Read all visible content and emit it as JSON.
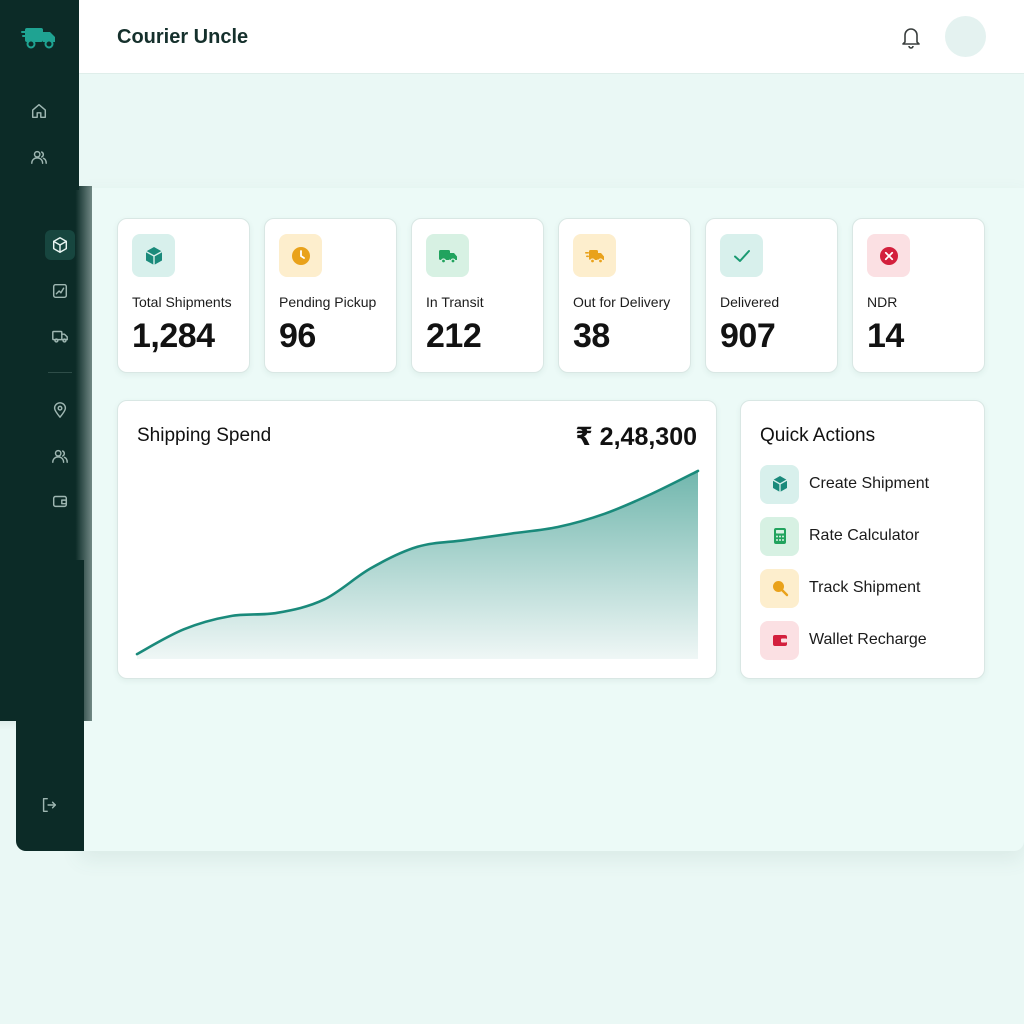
{
  "app": {
    "brand": "Courier Uncle"
  },
  "colors": {
    "sidebar": "#0c2b27",
    "accent": "#1a8a7b",
    "teal_bg": "#d8f0ec",
    "amber": "#e9a21b",
    "amber_bg": "#fdeecd",
    "green": "#21a35e",
    "green_bg": "#d7f1e3",
    "red": "#d3203d",
    "red_bg": "#fbe0e3"
  },
  "sidebar": {
    "logo_icon": "truck-icon",
    "items": [
      {
        "icon": "home-icon",
        "active": false
      },
      {
        "icon": "users-icon",
        "active": false
      },
      {
        "icon": "package-icon",
        "active": true
      },
      {
        "icon": "chart-icon",
        "active": false
      },
      {
        "icon": "truck-icon",
        "active": false
      },
      {
        "icon": "location-icon",
        "active": false
      },
      {
        "icon": "users-icon",
        "active": false
      },
      {
        "icon": "wallet-icon",
        "active": false
      },
      {
        "icon": "logout-icon",
        "active": false
      }
    ]
  },
  "header": {
    "bell_icon": "bell-icon",
    "avatar": "avatar"
  },
  "stats": [
    {
      "label": "Total Shipments",
      "value": "1,284",
      "icon": "package-icon"
    },
    {
      "label": "Pending Pickup",
      "value": "96",
      "icon": "clock-icon"
    },
    {
      "label": "In Transit",
      "value": "212",
      "icon": "truck-icon"
    },
    {
      "label": "Out for Delivery",
      "value": "38",
      "icon": "fast-truck-icon"
    },
    {
      "label": "Delivered",
      "value": "907",
      "icon": "check-icon"
    },
    {
      "label": "NDR",
      "value": "14",
      "icon": "x-circle-icon"
    }
  ],
  "spend": {
    "title": "Shipping Spend",
    "total": "₹ 2,48,300"
  },
  "chart_data": {
    "type": "area",
    "x": [
      0,
      1,
      2,
      3,
      4,
      5,
      6,
      7,
      8,
      9,
      10,
      11,
      12
    ],
    "values": [
      3,
      18,
      26,
      28,
      36,
      55,
      68,
      72,
      76,
      80,
      88,
      100,
      114
    ],
    "ylim": [
      0,
      120
    ],
    "grid": false
  },
  "quick_actions": {
    "title": "Quick Actions",
    "items": [
      {
        "label": "Create Shipment",
        "icon": "package-icon"
      },
      {
        "label": "Rate Calculator",
        "icon": "calculator-icon"
      },
      {
        "label": "Track Shipment",
        "icon": "search-icon"
      },
      {
        "label": "Wallet Recharge",
        "icon": "wallet-icon"
      }
    ]
  }
}
